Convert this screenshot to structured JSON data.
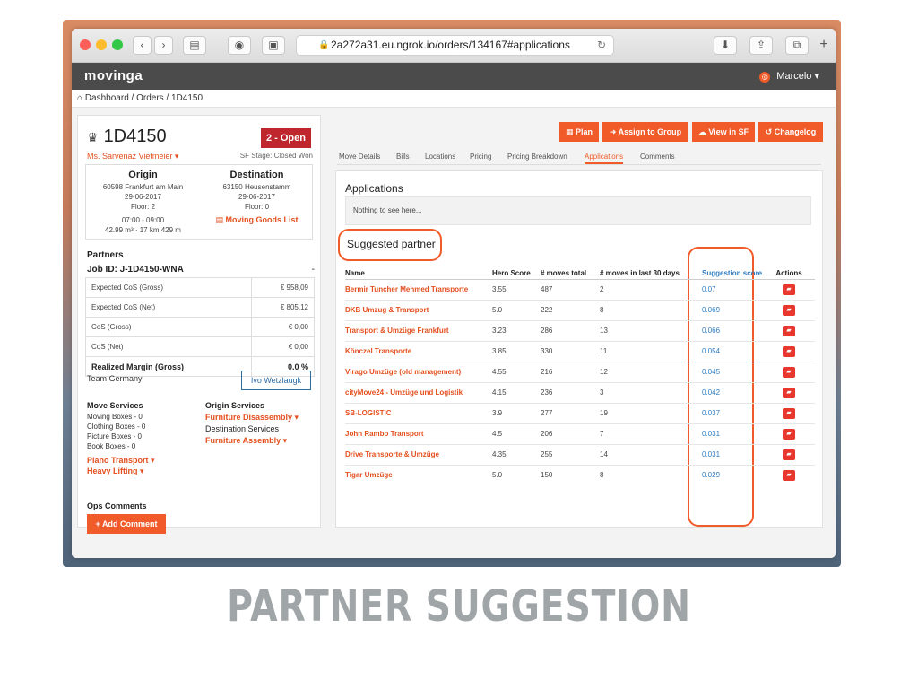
{
  "browser": {
    "url": "2a272a31.eu.ngrok.io/orders/134167#applications",
    "new_tab": "+"
  },
  "app": {
    "logo": "movinga",
    "user": "Marcelo ▾"
  },
  "breadcrumb": "Dashboard / Orders / 1D4150",
  "order": {
    "id": "1D4150",
    "status": "2 - Open",
    "customer": "Ms. Sarvenaz Vietmeier ▾",
    "sf_stage": "SF Stage: Closed Won",
    "origin": {
      "heading": "Origin",
      "address": "60598 Frankfurt am Main",
      "date": "29-06-2017",
      "floor": "Floor: 2",
      "time": "07:00 - 09:00",
      "volume": "42.99 m³ · 17 km 429 m"
    },
    "destination": {
      "heading": "Destination",
      "address": "63150 Heusenstamm",
      "date": "29-06-2017",
      "floor": "Floor: 0",
      "moving_goods_list": "Moving Goods List"
    }
  },
  "partners": {
    "heading": "Partners",
    "job_id": "Job ID: J-1D4150-WNA",
    "job_dash": "-",
    "costs": [
      {
        "label": "Expected CoS (Gross)",
        "value": "€ 958,09"
      },
      {
        "label": "Expected CoS (Net)",
        "value": "€ 805,12"
      },
      {
        "label": "CoS (Gross)",
        "value": "€ 0,00"
      },
      {
        "label": "CoS (Net)",
        "value": "€ 0,00"
      },
      {
        "label": "Realized Margin (Gross)",
        "value": "0.0 %"
      }
    ]
  },
  "team": {
    "name": "Team Germany",
    "agent": "Ivo Wetzlaugk"
  },
  "move_services": {
    "heading": "Move Services",
    "items": [
      "Moving Boxes - 0",
      "Clothing Boxes - 0",
      "Picture Boxes - 0",
      "Book Boxes - 0"
    ],
    "extras": [
      "Piano Transport ▾",
      "Heavy Lifting ▾"
    ]
  },
  "origin_services": {
    "heading": "Origin Services",
    "items": [
      "Furniture Disassembly ▾"
    ]
  },
  "destination_services": {
    "heading": "Destination Services",
    "items": [
      "Furniture Assembly ▾"
    ]
  },
  "ops": {
    "heading": "Ops Comments",
    "add_button": "+ Add Comment"
  },
  "action_buttons": {
    "plan": "Plan",
    "assign": "Assign to Group",
    "view_sf": "View in SF",
    "changelog": "Changelog"
  },
  "tabs": [
    "Move Details",
    "Bills",
    "Locations",
    "Pricing",
    "Pricing Breakdown",
    "Applications",
    "Comments"
  ],
  "applications": {
    "heading": "Applications",
    "empty_text": "Nothing to see here..."
  },
  "suggested": {
    "heading": "Suggested partner",
    "columns": {
      "name": "Name",
      "hero": "Hero Score",
      "moves_total": "# moves total",
      "moves_30": "# moves in last 30 days",
      "suggestion": "Suggestion score",
      "actions": "Actions"
    },
    "rows": [
      {
        "name": "Bermir Tuncher Mehmed Transporte",
        "hero": "3.55",
        "total": "487",
        "last30": "2",
        "score": "0.07"
      },
      {
        "name": "DKB Umzug & Transport",
        "hero": "5.0",
        "total": "222",
        "last30": "8",
        "score": "0.069"
      },
      {
        "name": "Transport & Umzüge Frankfurt",
        "hero": "3.23",
        "total": "286",
        "last30": "13",
        "score": "0.066"
      },
      {
        "name": "Könczel Transporte",
        "hero": "3.85",
        "total": "330",
        "last30": "11",
        "score": "0.054"
      },
      {
        "name": "Virago Umzüge (old management)",
        "hero": "4.55",
        "total": "216",
        "last30": "12",
        "score": "0.045"
      },
      {
        "name": "cityMove24 - Umzüge und Logistik",
        "hero": "4.15",
        "total": "236",
        "last30": "3",
        "score": "0.042"
      },
      {
        "name": "SB-LOGISTIC",
        "hero": "3.9",
        "total": "277",
        "last30": "19",
        "score": "0.037"
      },
      {
        "name": "John Rambo Transport",
        "hero": "4.5",
        "total": "206",
        "last30": "7",
        "score": "0.031"
      },
      {
        "name": "Drive Transporte & Umzüge",
        "hero": "4.35",
        "total": "255",
        "last30": "14",
        "score": "0.031"
      },
      {
        "name": "Tigar Umzüge",
        "hero": "5.0",
        "total": "150",
        "last30": "8",
        "score": "0.029"
      }
    ]
  },
  "slide_title": "PARTNER SUGGESTION",
  "colors": {
    "accent": "#f15a29",
    "status_open": "#c0262d",
    "score_blue": "#2f7cc0"
  },
  "icons": [
    "crown-icon",
    "lock-icon",
    "reload-icon",
    "document-icon",
    "calendar-icon",
    "sign-in-icon",
    "cloud-icon",
    "history-icon",
    "handshake-icon"
  ]
}
